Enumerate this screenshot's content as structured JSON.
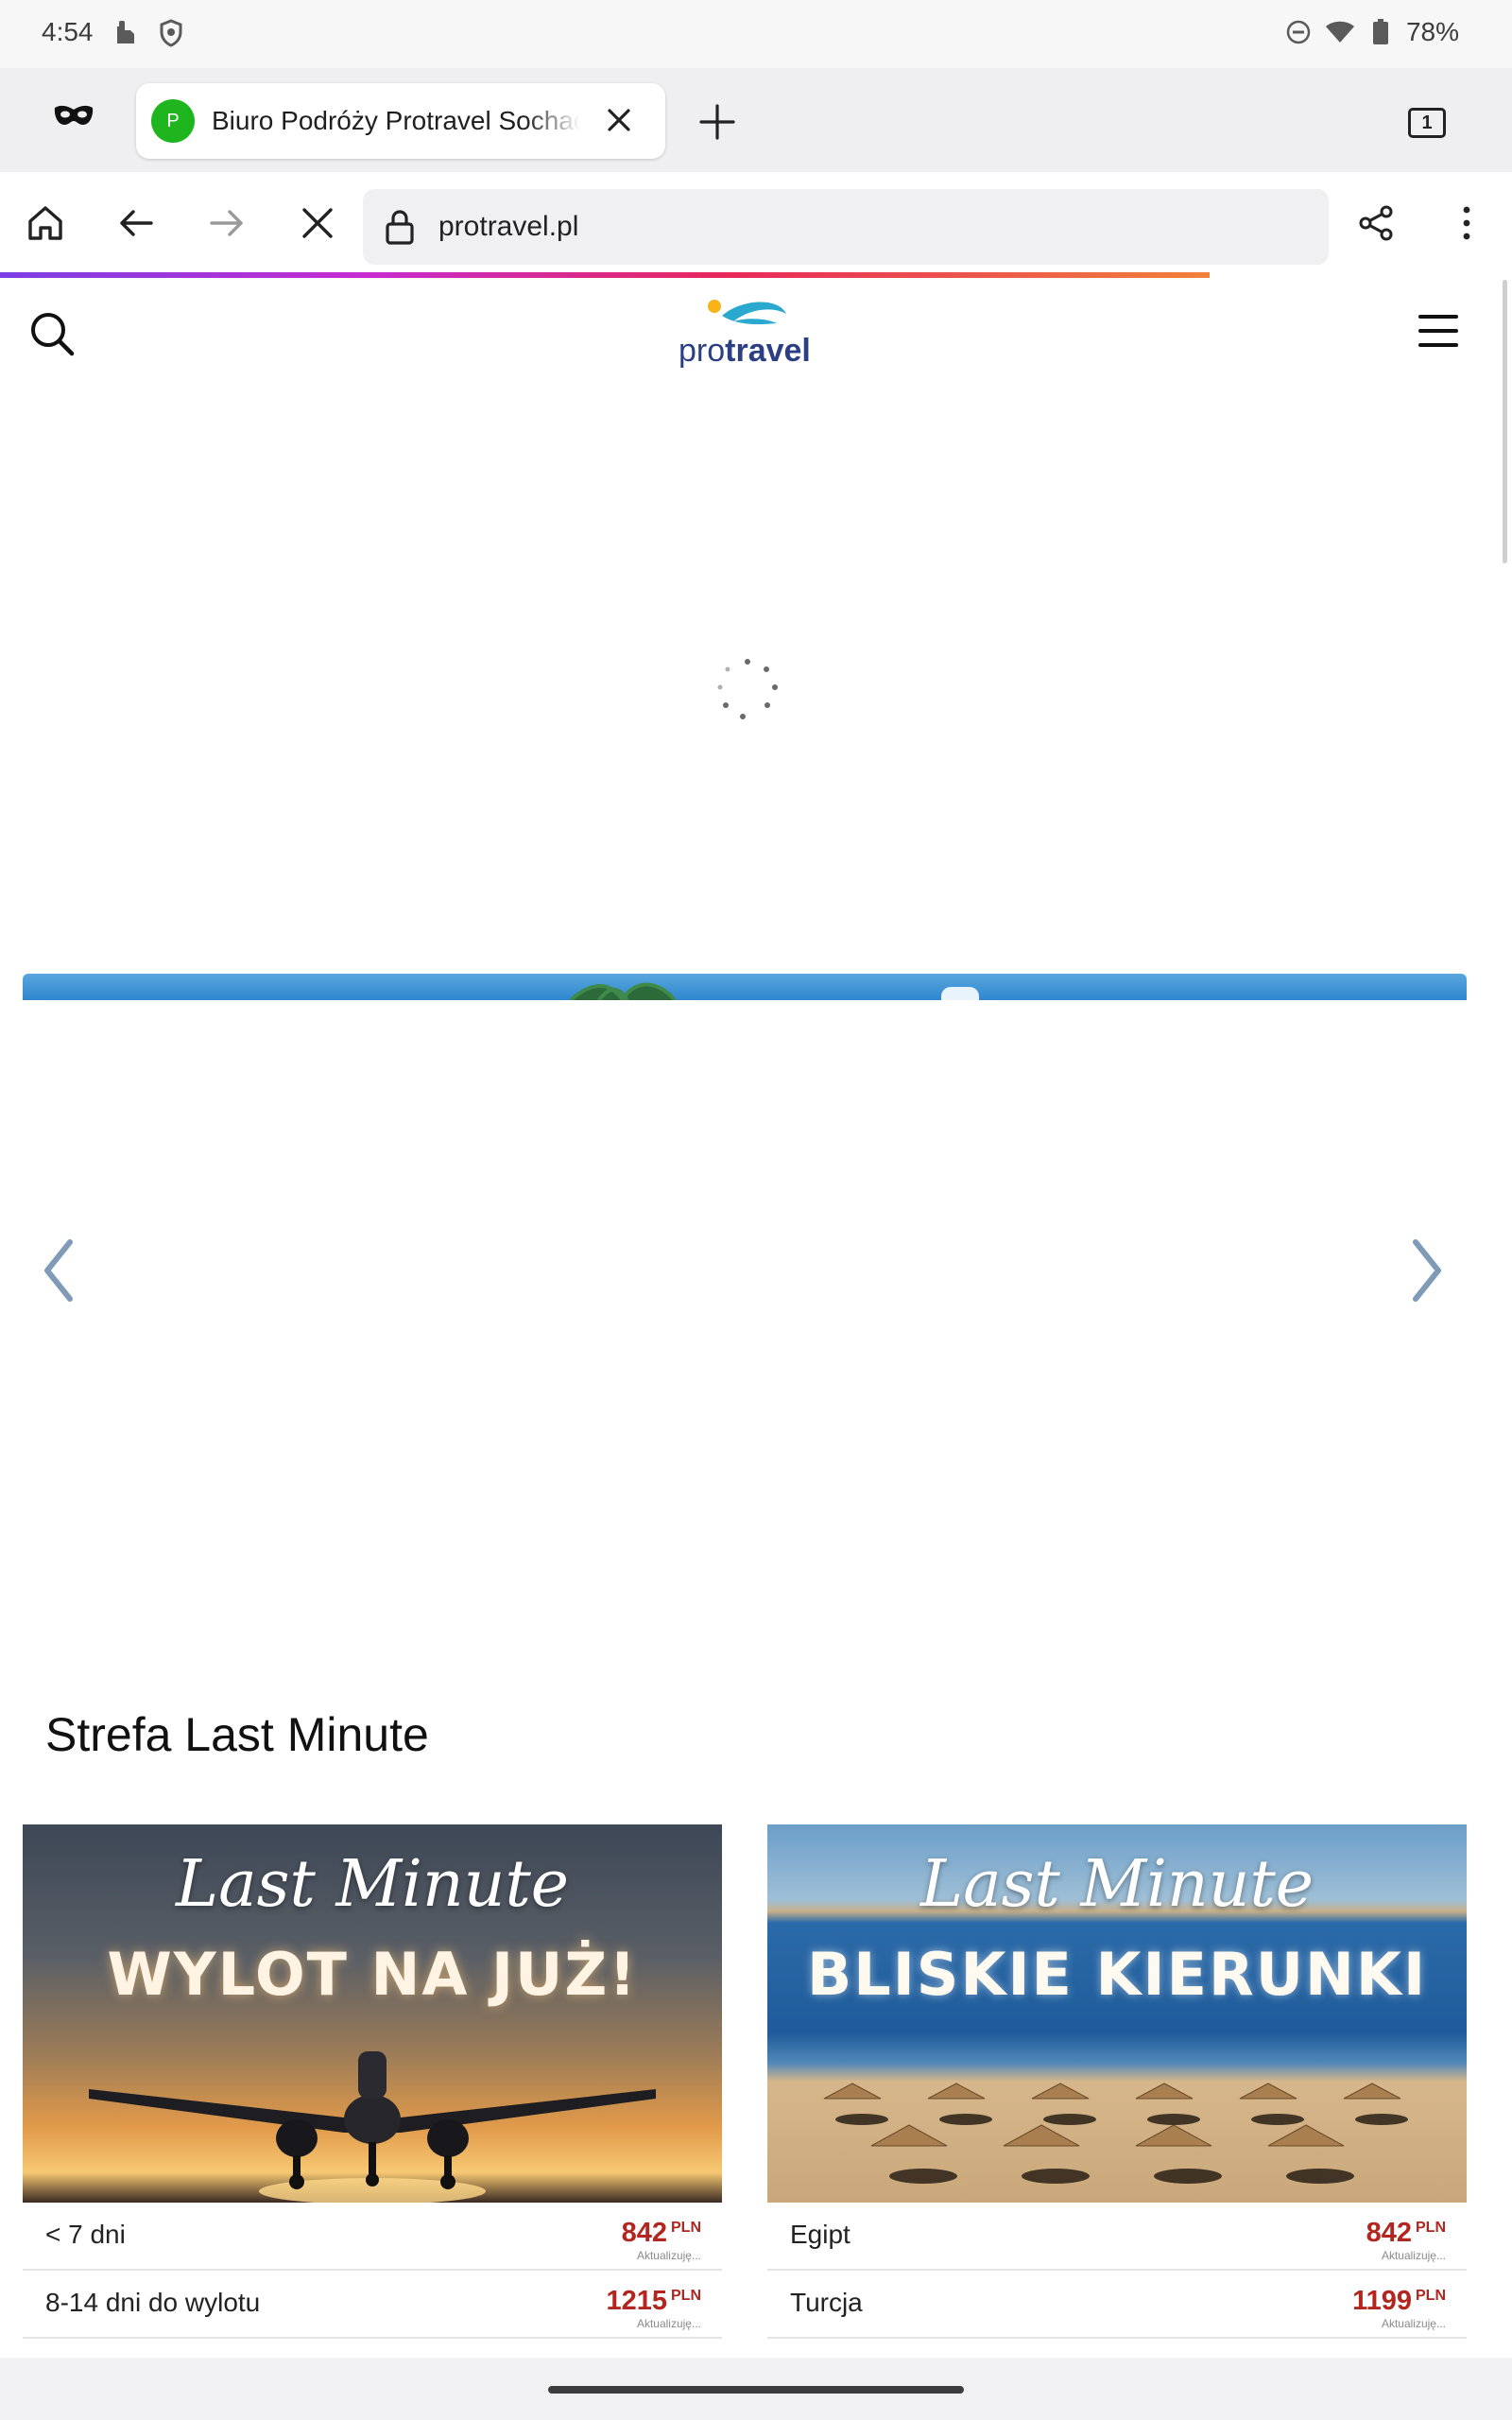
{
  "status_bar": {
    "time": "4:54",
    "battery": "78%",
    "icons": [
      "notification-icon",
      "shield-icon",
      "do-not-disturb-icon",
      "wifi-icon",
      "battery-icon"
    ]
  },
  "tabs": {
    "active_tab_title": "Biuro Podróży Protravel Sochaczew",
    "active_tab_favicon_letter": "P",
    "tab_count": "1"
  },
  "toolbar": {
    "url": "protravel.pl",
    "page_load_progress": 0.8
  },
  "site": {
    "logo_pre": "pro",
    "logo_bold": "travel"
  },
  "last_minute": {
    "section_title": "Strefa Last Minute",
    "cards": [
      {
        "script_title": "Last Minute",
        "block_title": "WYLOT NA JUŻ!",
        "rows": [
          {
            "label": "< 7 dni",
            "price": "842",
            "currency": "PLN",
            "note": "Aktualizuję..."
          },
          {
            "label": "8-14 dni do wylotu",
            "price": "1215",
            "currency": "PLN",
            "note": "Aktualizuję..."
          }
        ]
      },
      {
        "script_title": "Last Minute",
        "block_title": "BLISKIE KIERUNKI",
        "rows": [
          {
            "label": "Egipt",
            "price": "842",
            "currency": "PLN",
            "note": "Aktualizuję..."
          },
          {
            "label": "Turcja",
            "price": "1199",
            "currency": "PLN",
            "note": "Aktualizuję..."
          }
        ]
      }
    ]
  },
  "colors": {
    "price": "#b2261f",
    "logo": "#2c3f84",
    "favicon": "#1fb51f",
    "carousel_arrow": "#7f9bb8"
  }
}
